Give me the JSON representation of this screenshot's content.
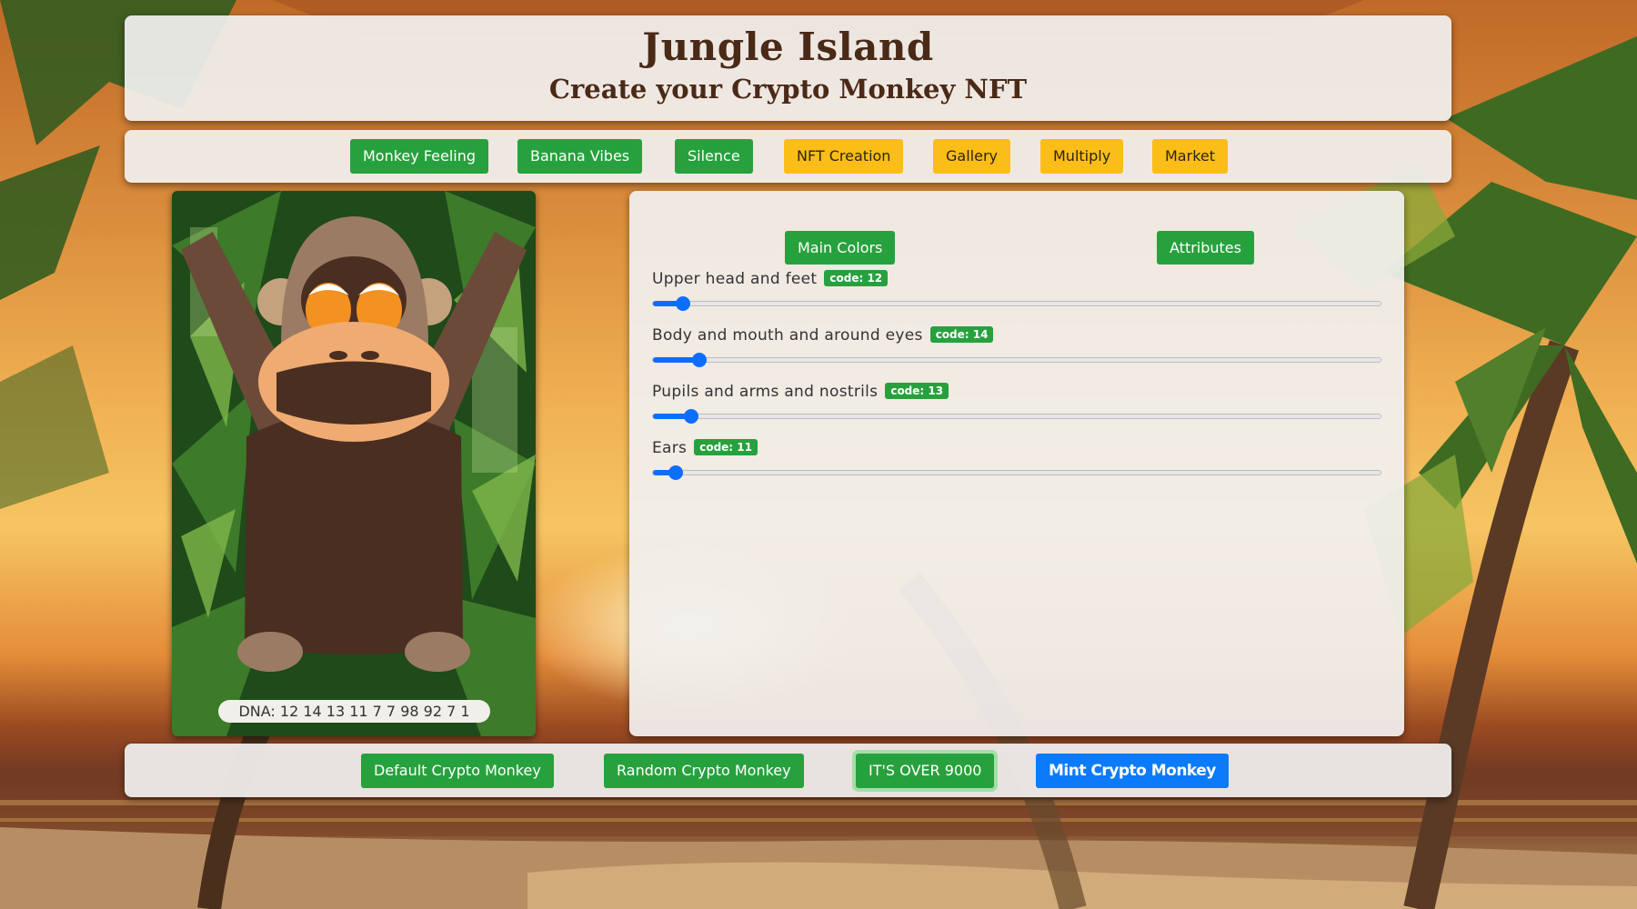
{
  "header": {
    "title": "Jungle Island",
    "subtitle": "Create your Crypto Monkey NFT"
  },
  "nav": {
    "items": [
      {
        "label": "Monkey Feeling",
        "variant": "green"
      },
      {
        "label": "Banana Vibes",
        "variant": "green"
      },
      {
        "label": "Silence",
        "variant": "green"
      },
      {
        "label": "NFT Creation",
        "variant": "yellow"
      },
      {
        "label": "Gallery",
        "variant": "yellow"
      },
      {
        "label": "Multiply",
        "variant": "yellow"
      },
      {
        "label": "Market",
        "variant": "yellow"
      }
    ]
  },
  "preview": {
    "dna": "DNA: 12 14 13 11 7 7 98 92 7 1"
  },
  "panel": {
    "tabs": [
      {
        "label": "Main Colors"
      },
      {
        "label": "Attributes"
      }
    ],
    "sliders": [
      {
        "label": "Upper head and feet",
        "code": "code: 12",
        "value": 12,
        "min": 10,
        "max": 98
      },
      {
        "label": "Body and mouth and around eyes",
        "code": "code: 14",
        "value": 14,
        "min": 10,
        "max": 98
      },
      {
        "label": "Pupils and arms and nostrils",
        "code": "code: 13",
        "value": 13,
        "min": 10,
        "max": 98
      },
      {
        "label": "Ears",
        "code": "code: 11",
        "value": 11,
        "min": 10,
        "max": 98
      }
    ]
  },
  "footer": {
    "default_label": "Default Crypto Monkey",
    "random_label": "Random Crypto Monkey",
    "over_label": "IT'S OVER 9000",
    "mint_label": "Mint Crypto Monkey"
  },
  "colors": {
    "green": "#27a13d",
    "yellow": "#fbbd17",
    "blue": "#0b7bfb",
    "monkey_head": "#9b7b64",
    "monkey_body": "#4a2e21",
    "monkey_arms": "#6b4a39",
    "monkey_face": "#f0ab72",
    "monkey_eyes": "#f39221"
  }
}
